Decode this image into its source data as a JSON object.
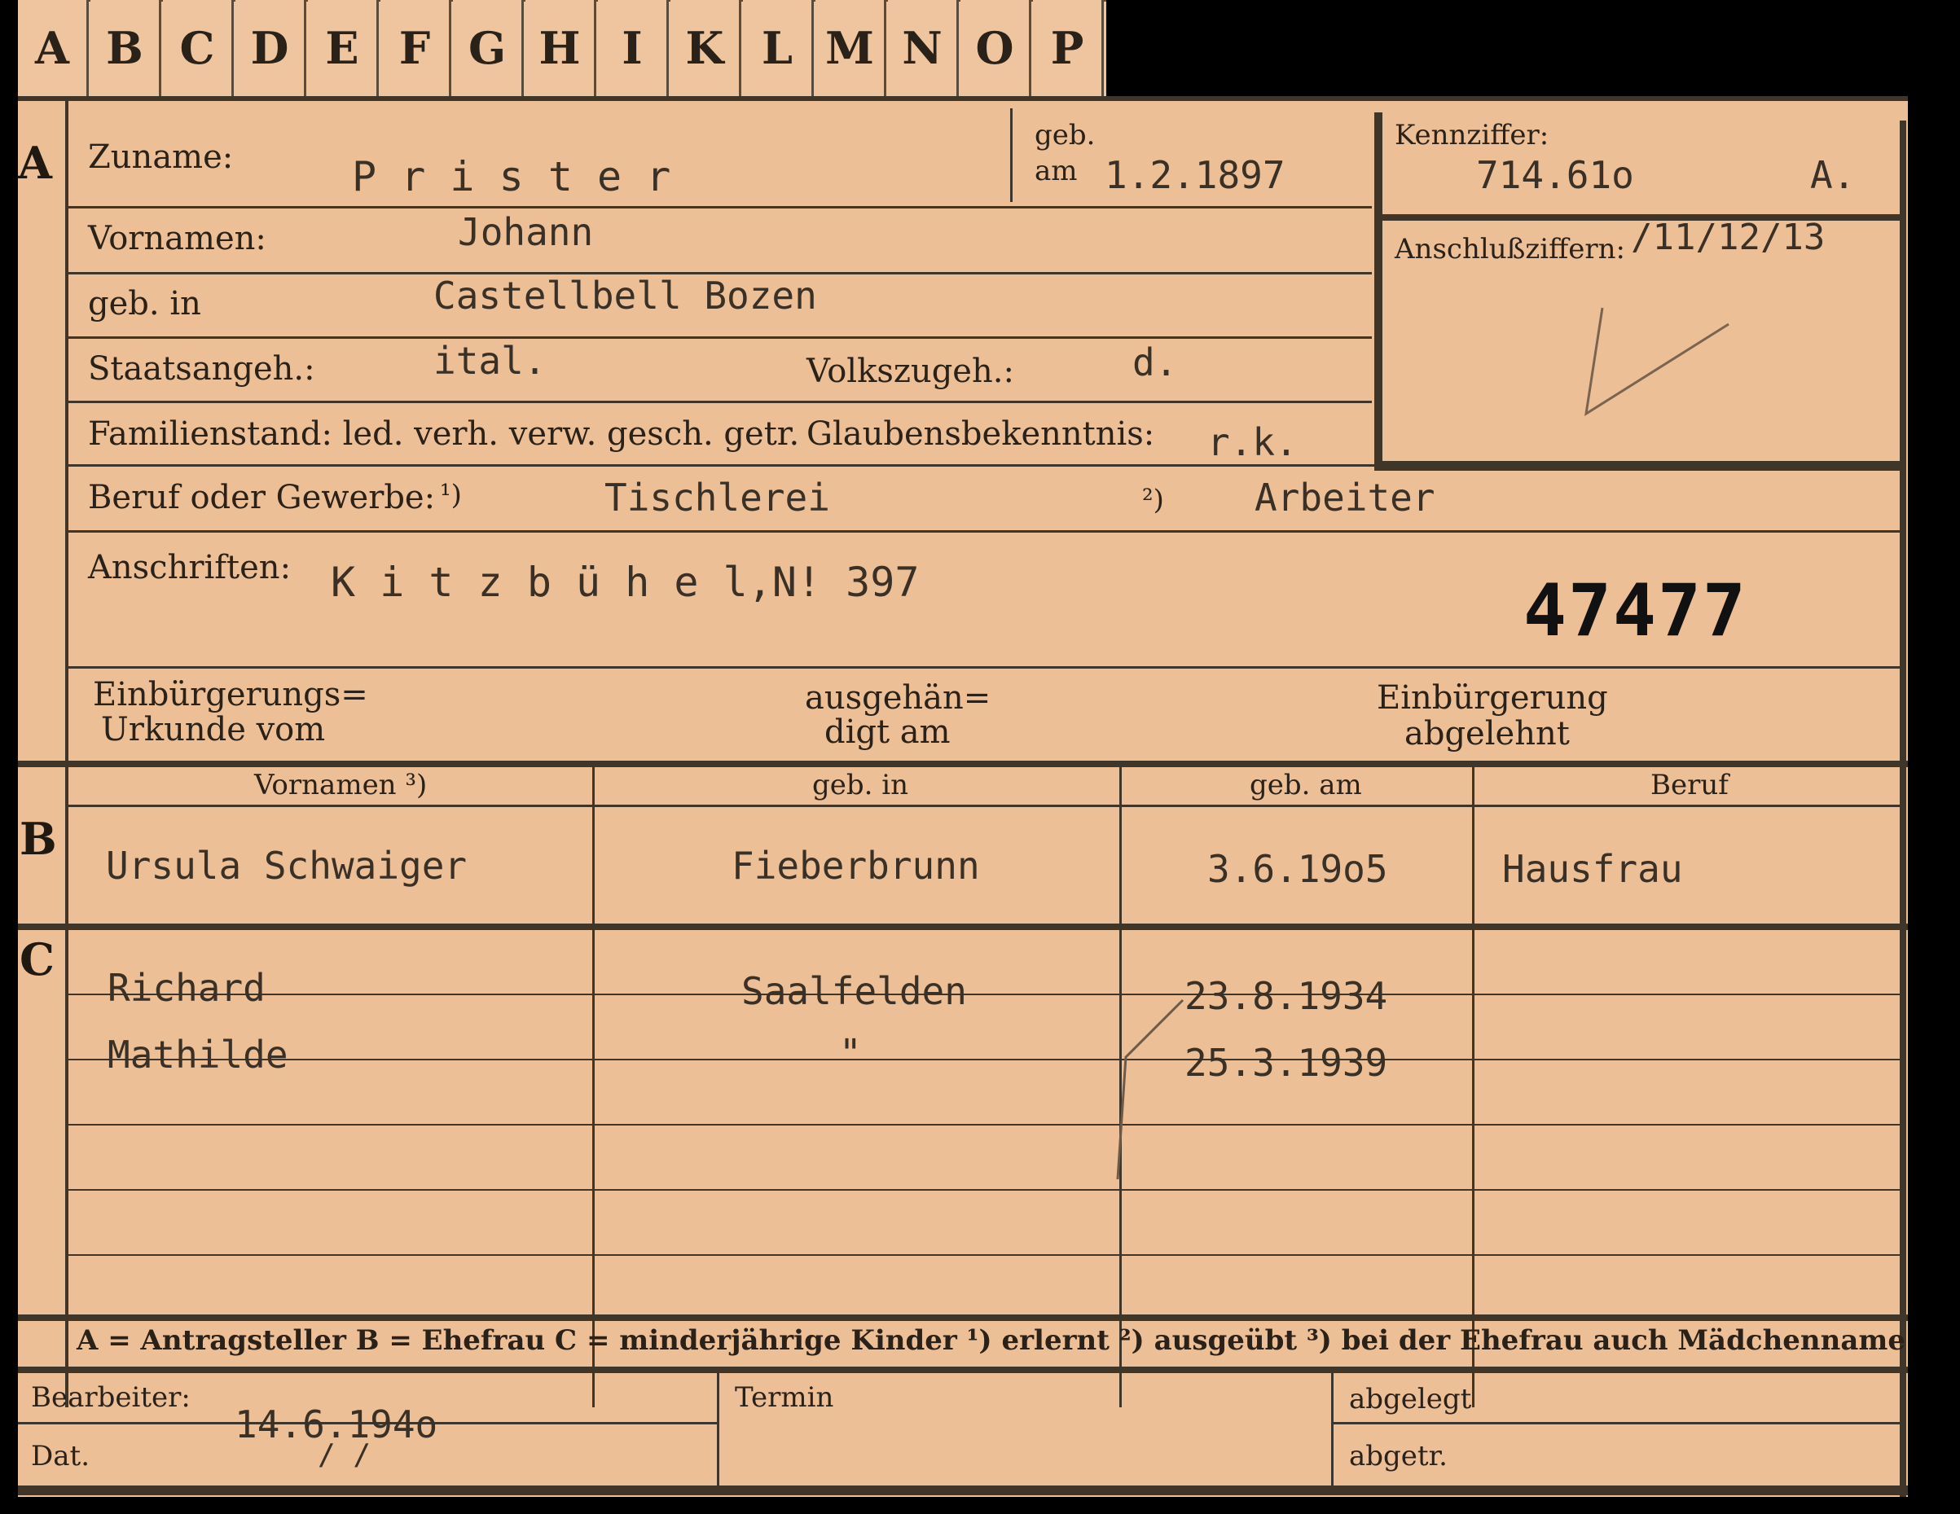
{
  "tabs": [
    "A",
    "B",
    "C",
    "D",
    "E",
    "F",
    "G",
    "H",
    "I",
    "K",
    "L",
    "M",
    "N",
    "O",
    "P"
  ],
  "sections": {
    "a": "A",
    "b": "B",
    "c": "C"
  },
  "labels": {
    "zuname": "Zuname:",
    "geb_am_top": "geb.",
    "geb_am_bottom": "am",
    "kennziffer": "Kennziffer:",
    "vornamen": "Vornamen:",
    "anschlussziffern": "Anschlußziffern:",
    "geb_in": "geb. in",
    "staatsangeh": "Staatsangeh.:",
    "volkszugeh": "Volkszugeh.:",
    "familienstand": "Familienstand: led. verh. verw. gesch. getr.",
    "glaubensbekenntnis": "Glaubensbekenntnis:",
    "beruf": "Beruf oder Gewerbe:",
    "note1": "¹)",
    "note2": "²)",
    "anschriften": "Anschriften:",
    "einbuergerungs_1": "Einbürgerungs=",
    "einbuergerungs_2": "Urkunde vom",
    "ausgehaendigt_1": "ausgehän=",
    "ausgehaendigt_2": "digt am",
    "abgelehnt_1": "Einbürgerung",
    "abgelehnt_2": "abgelehnt"
  },
  "person": {
    "zuname": "P r i s t e r",
    "geb_am": "1.2.1897",
    "kennziffer": "714.61o",
    "kennziffer_suffix": "A.",
    "vornamen": "Johann",
    "anschlussziffern": "/11/12/13",
    "geb_in": "Castellbell Bozen",
    "staatsangeh": "ital.",
    "volkszugeh": "d.",
    "glaubensbekenntnis": "r.k.",
    "beruf_erlernt": "Tischlerei",
    "beruf_ausgeuebt": "Arbeiter",
    "anschriften": "K i t z b ü h e l,N! 397",
    "stamp_number": "47477"
  },
  "table_headers": {
    "vornamen": "Vornamen ³)",
    "geb_in": "geb. in",
    "geb_am": "geb. am",
    "beruf": "Beruf"
  },
  "spouse": {
    "name": "Ursula Schwaiger",
    "geb_in": "Fieberbrunn",
    "geb_am": "3.6.19o5",
    "beruf": "Hausfrau"
  },
  "children": [
    {
      "name": "Richard",
      "geb_in": "Saalfelden",
      "geb_am": "23.8.1934"
    },
    {
      "name": "Mathilde",
      "geb_in": "\"",
      "geb_am": "25.3.1939"
    }
  ],
  "legend": "A = Antragsteller   B = Ehefrau   C = minderjährige Kinder   ¹) erlernt   ²) ausgeübt   ³) bei der Ehefrau auch Mädchenname",
  "footer": {
    "bearbeiter": "Bearbeiter:",
    "date_value": "14.6.194o",
    "dat": "Dat.",
    "dat_slashes": "/          /",
    "termin": "Termin",
    "abgelegt": "abgelegt",
    "abgetr": "abgetr."
  },
  "colors": {
    "card": "#ecbf97",
    "ink": "#2a2118",
    "rule": "#3f3528",
    "pencil_blue": "#2b4f8e"
  }
}
